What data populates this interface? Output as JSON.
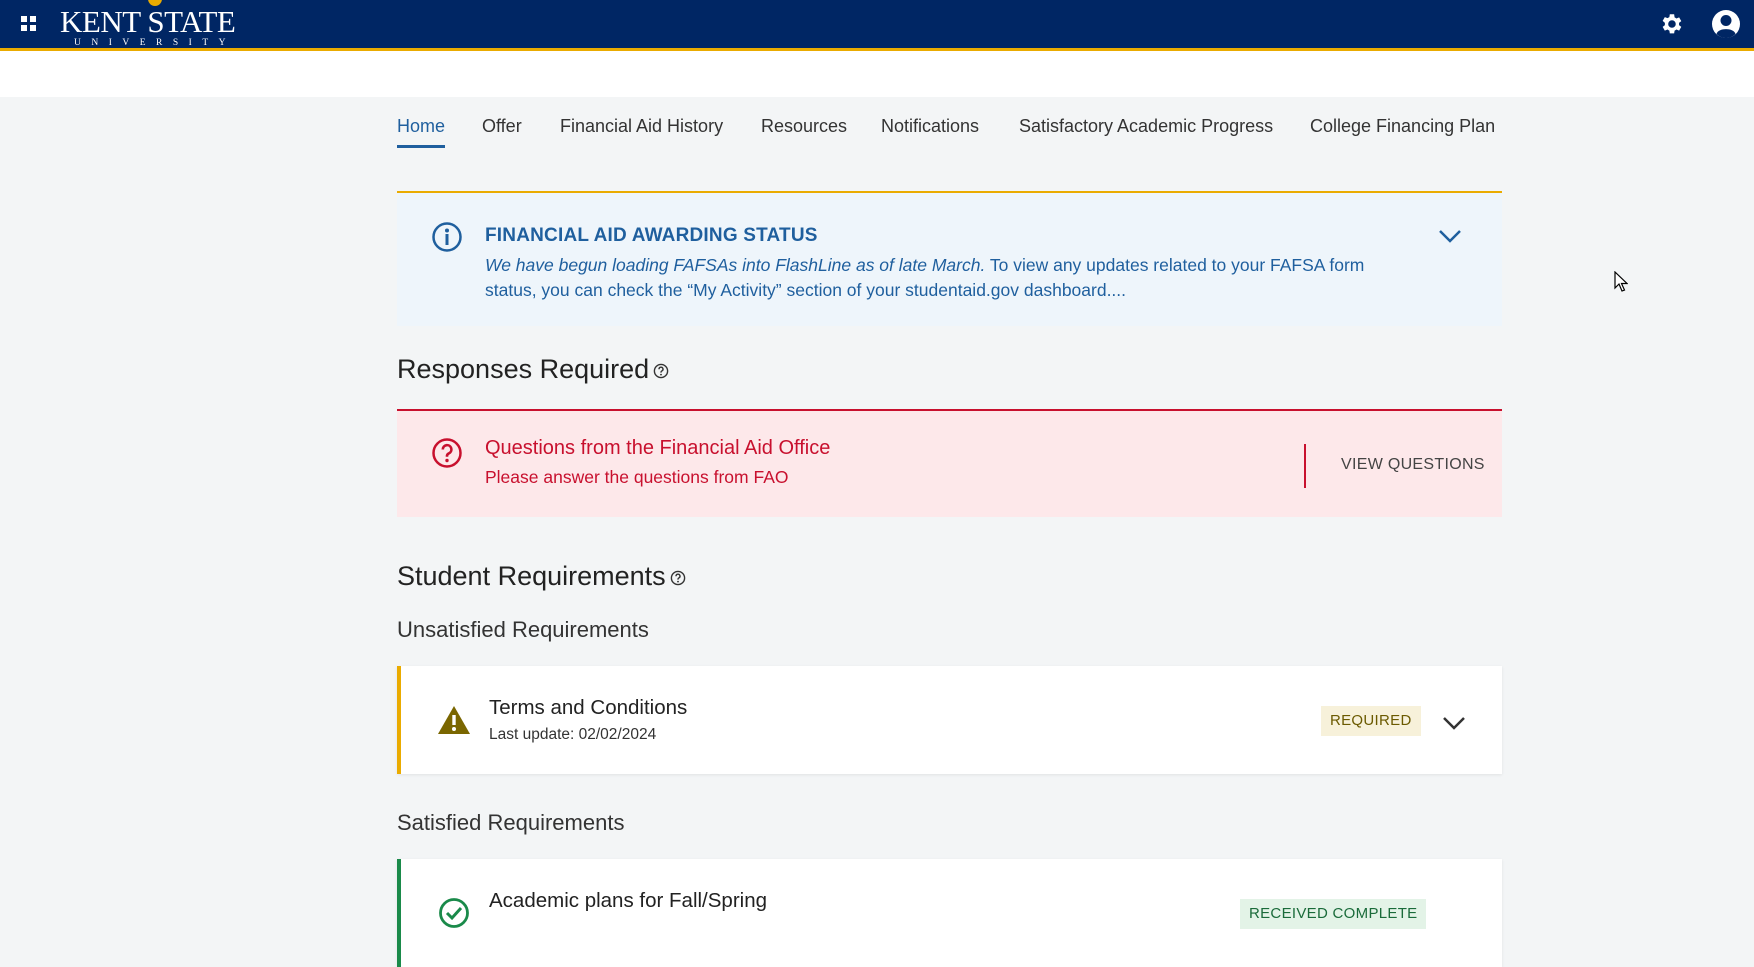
{
  "header": {
    "logo_name": "KENT STATE",
    "logo_sub": "UNIVERSITY",
    "apps_icon": "grid-icon",
    "settings_icon": "gear-icon",
    "user_icon": "user-icon",
    "colors": {
      "navy": "#002664",
      "gold": "#eaab00"
    }
  },
  "nav": {
    "tabs": [
      {
        "label": "Home",
        "active": true
      },
      {
        "label": "Offer"
      },
      {
        "label": "Financial Aid History"
      },
      {
        "label": "Resources"
      },
      {
        "label": "Notifications"
      },
      {
        "label": "Satisfactory Academic Progress"
      },
      {
        "label": "College Financing Plan"
      }
    ]
  },
  "info_banner": {
    "title": "FINANCIAL AID AWARDING STATUS",
    "text_italic": "We have begun loading FAFSAs into FlashLine as of late March.",
    "text_rest": " To view any updates related to your FAFSA form status, you can check the “My Activity” section of your studentaid.gov dashboard....",
    "color": "#1f5f9e"
  },
  "responses": {
    "section_title": "Responses Required",
    "item_title": "Questions from the Financial Aid Office",
    "item_sub": "Please answer the questions from FAO",
    "action_label": "VIEW QUESTIONS",
    "color": "#c8102e"
  },
  "student_requirements": {
    "section_title": "Student Requirements",
    "unsatisfied_title": "Unsatisfied Requirements",
    "satisfied_title": "Satisfied Requirements",
    "unsatisfied": [
      {
        "title": "Terms and Conditions",
        "date": "Last update: 02/02/2024",
        "badge": "REQUIRED"
      }
    ],
    "satisfied": [
      {
        "title": "Academic plans for Fall/Spring",
        "badge": "RECEIVED COMPLETE"
      }
    ]
  }
}
